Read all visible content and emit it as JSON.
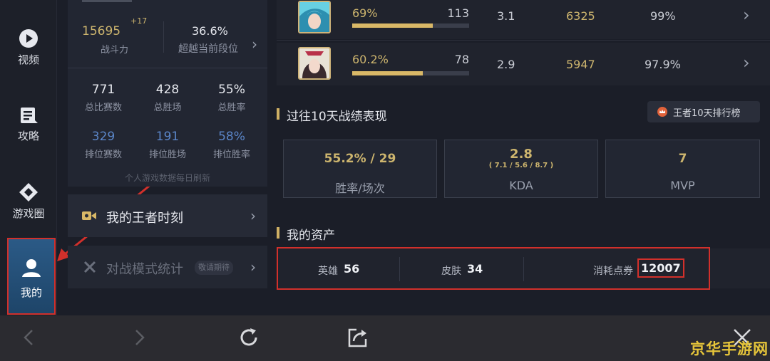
{
  "nav": {
    "items": [
      {
        "label": "视频",
        "icon": "play-circle-icon"
      },
      {
        "label": "攻略",
        "icon": "guide-icon"
      },
      {
        "label": "游戏圈",
        "icon": "community-icon"
      },
      {
        "label": "我的",
        "icon": "user-icon"
      }
    ]
  },
  "profile": {
    "power_value": "15695",
    "power_delta": "+17",
    "power_label": "战斗力",
    "surpass_value": "36.6%",
    "surpass_label": "超越当前段位",
    "stats": [
      {
        "value": "771",
        "label": "总比赛数"
      },
      {
        "value": "428",
        "label": "总胜场"
      },
      {
        "value": "55%",
        "label": "总胜率"
      },
      {
        "value": "329",
        "label": "排位赛数"
      },
      {
        "value": "191",
        "label": "排位胜场"
      },
      {
        "value": "58%",
        "label": "排位胜率"
      }
    ],
    "refresh_note": "个人游戏数据每日刷新"
  },
  "menu": {
    "moments_label": "我的王者时刻",
    "modes_label": "对战模式统计",
    "modes_badge": "敬请期待"
  },
  "heroes": [
    {
      "win_rate": "69%",
      "win_rate_fraction": 0.69,
      "games": "113",
      "kda": "3.1",
      "score": "6325",
      "percent": "99%"
    },
    {
      "win_rate": "60.2%",
      "win_rate_fraction": 0.602,
      "games": "78",
      "kda": "2.9",
      "score": "5947",
      "percent": "97.9%"
    }
  ],
  "recent": {
    "title": "过往10天战绩表现",
    "rank_button": "王者10天排行榜",
    "winrate_value": "55.2% / 29",
    "winrate_label": "胜率/场次",
    "kda_value": "2.8",
    "kda_detail": "( 7.1 / 5.6 / 8.7 )",
    "kda_label": "KDA",
    "mvp_value": "7",
    "mvp_label": "MVP"
  },
  "assets": {
    "title": "我的资产",
    "hero_label": "英雄",
    "hero_value": "56",
    "skin_label": "皮肤",
    "skin_value": "34",
    "coupon_label": "消耗点券",
    "coupon_value": "12007"
  },
  "watermark": "京华手游网",
  "colors": {
    "accent_gold": "#cdb56e",
    "highlight_red": "#d2302b",
    "ranked_blue": "#5b86c9"
  }
}
